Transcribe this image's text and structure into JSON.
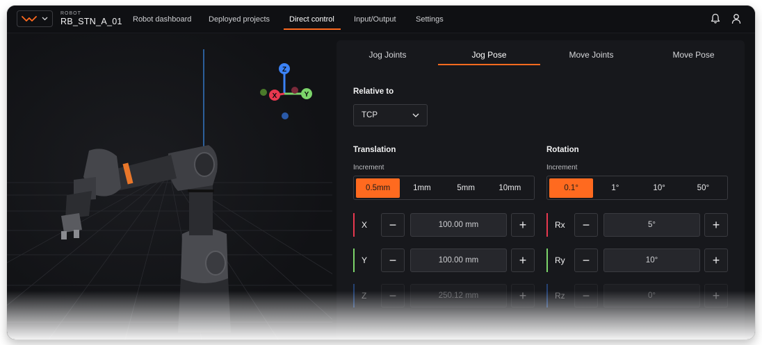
{
  "header": {
    "logo_icon": "wave-logo-icon",
    "robot_label": "ROBOT",
    "robot_name": "RB_STN_A_01",
    "nav": [
      "Robot dashboard",
      "Deployed projects",
      "Direct control",
      "Input/Output",
      "Settings"
    ],
    "active_nav": "Direct control",
    "icons": [
      "bell-icon",
      "user-icon"
    ]
  },
  "viewport": {
    "axes": {
      "z": "Z",
      "x": "X",
      "y": "Y"
    }
  },
  "panel": {
    "tabs": [
      "Jog Joints",
      "Jog Pose",
      "Move Joints",
      "Move Pose"
    ],
    "active_tab": "Jog Pose",
    "relative_to": {
      "label": "Relative to",
      "value": "TCP"
    },
    "translation": {
      "label": "Translation",
      "increment_label": "Increment",
      "increments": [
        "0.5mm",
        "1mm",
        "5mm",
        "10mm"
      ],
      "active_increment": "0.5mm",
      "rows": [
        {
          "axis": "X",
          "value": "100.00 mm",
          "color": "#e8384f",
          "disabled": false
        },
        {
          "axis": "Y",
          "value": "100.00 mm",
          "color": "#7cd46a",
          "disabled": false
        },
        {
          "axis": "Z",
          "value": "250.12 mm",
          "color": "#3b82f6",
          "disabled": true
        }
      ]
    },
    "rotation": {
      "label": "Rotation",
      "increment_label": "Increment",
      "increments": [
        "0.1°",
        "1°",
        "10°",
        "50°"
      ],
      "active_increment": "0.1°",
      "rows": [
        {
          "axis": "Rx",
          "value": "5°",
          "color": "#e8384f",
          "disabled": false
        },
        {
          "axis": "Ry",
          "value": "10°",
          "color": "#7cd46a",
          "disabled": false
        },
        {
          "axis": "Rz",
          "value": "0°",
          "color": "#3b82f6",
          "disabled": true
        }
      ]
    }
  },
  "colors": {
    "accent": "#ff6a1f",
    "background": "#111215",
    "panel": "#17181c"
  }
}
